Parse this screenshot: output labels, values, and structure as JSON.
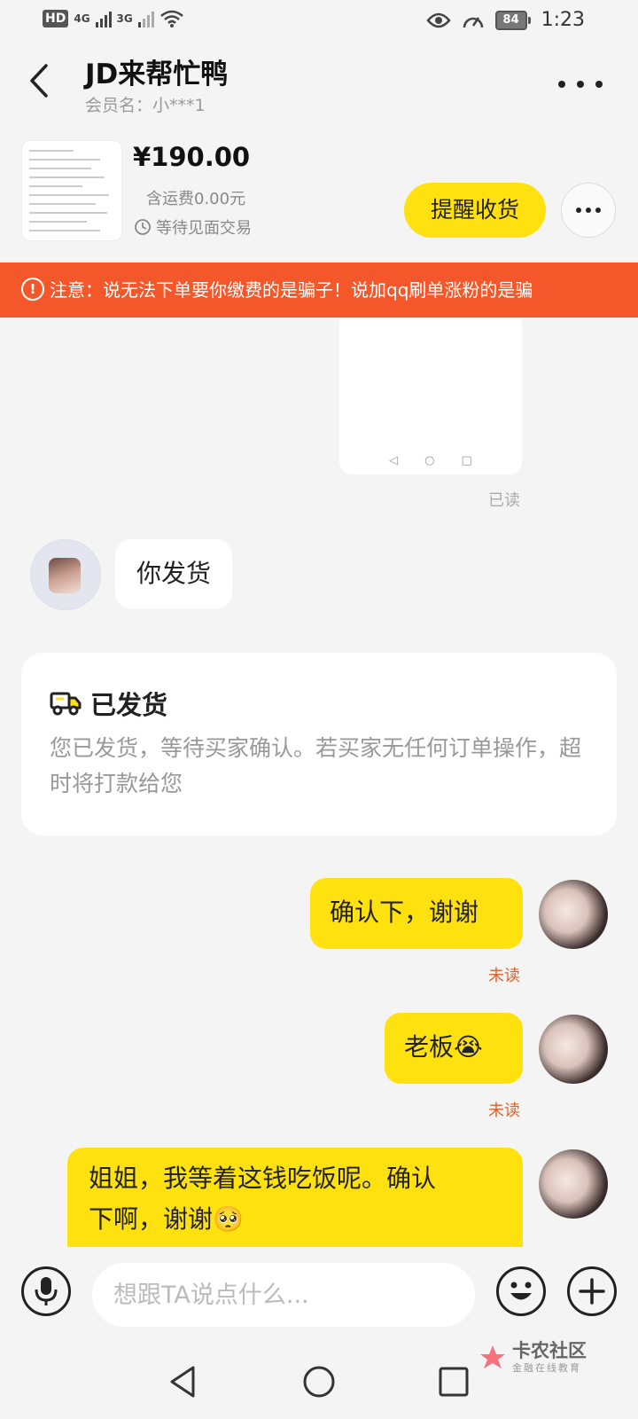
{
  "status_bar": {
    "hd": "HD",
    "net1": "4G",
    "net2": "3G",
    "battery": "84",
    "time": "1:23"
  },
  "header": {
    "title": "JD来帮忙鸭",
    "member": "会员名：小***1"
  },
  "product": {
    "price": "¥190.00",
    "shipping": "含运费0.00元",
    "status": "等待见面交易",
    "remind_button": "提醒收货"
  },
  "warning": {
    "text": "注意：说无法下单要你缴费的是骗子！说加qq刷单涨粉的是骗"
  },
  "chat": {
    "image_read": "已读",
    "msg_in": "你发货",
    "shipped_card": {
      "title": "已发货",
      "description": "您已发货，等待买家确认。若买家无任何订单操作，超时将打款给您"
    },
    "msg_out_1": "确认下，谢谢",
    "msg_out_1_status": "未读",
    "msg_out_2": "老板😭",
    "msg_out_2_status": "未读",
    "msg_out_3_line1": "姐姐，我等着这钱吃饭呢。确认",
    "msg_out_3_line2": "下啊，谢谢🥺"
  },
  "input": {
    "placeholder": "想跟TA说点什么..."
  },
  "watermark": {
    "name": "卡农社区",
    "tagline": "金融在线教育"
  },
  "icons": {
    "back": "chevron-left-icon",
    "more": "more-icon",
    "clock": "clock-icon",
    "warning": "alert-circle-icon",
    "truck": "truck-icon",
    "mic": "microphone-icon",
    "emoji": "smile-icon",
    "plus": "plus-icon"
  },
  "colors": {
    "accent_yellow": "#ffe10f",
    "warning_orange": "#f4582a",
    "unread_red": "#e0602a"
  }
}
